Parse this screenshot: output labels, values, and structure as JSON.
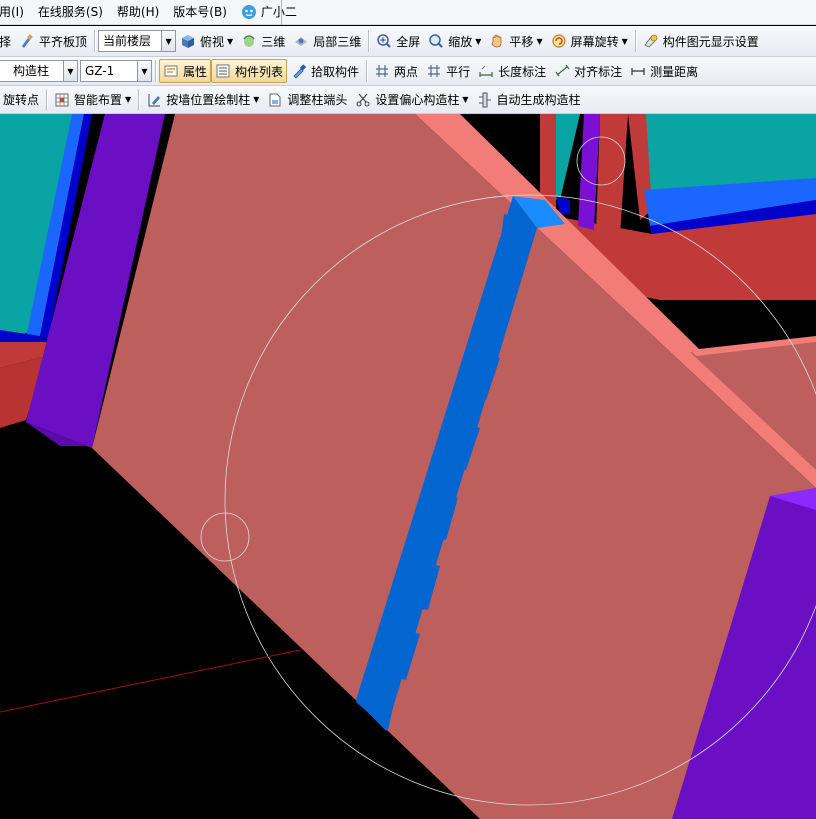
{
  "menu": {
    "items": [
      {
        "label": "用(I)"
      },
      {
        "label": "在线服务(S)"
      },
      {
        "label": "帮助(H)"
      },
      {
        "label": "版本号(B)"
      },
      {
        "label": "广小二"
      }
    ]
  },
  "toolbar1": {
    "left_cut_label": "择",
    "align_slab_top": "平齐板顶",
    "floor_scope_value": "当前楼层",
    "top_view": "俯视",
    "three_d": "三维",
    "local_3d": "局部三维",
    "fullscreen": "全屏",
    "zoom": "缩放",
    "pan": "平移",
    "screen_rotate": "屏幕旋转",
    "display_settings": "构件图元显示设置"
  },
  "toolbar2": {
    "component_type_value": "构造柱",
    "component_name_value": "GZ-1",
    "properties": "属性",
    "component_list": "构件列表",
    "pick_component": "拾取构件",
    "two_points": "两点",
    "parallel": "平行",
    "length_dim": "长度标注",
    "aligned_dim": "对齐标注",
    "measure_distance": "测量距离"
  },
  "toolbar3": {
    "rotate_point": "旋转点",
    "smart_layout": "智能布置",
    "draw_by_wall": "按墙位置绘制柱",
    "adjust_column_end": "调整柱端头",
    "set_eccentric": "设置偏心构造柱",
    "auto_generate": "自动生成构造柱"
  },
  "colors": {
    "wall_face": "#bd5f5d",
    "wall_top": "#f27d78",
    "column_purple": "#6a0fc4",
    "constructional_column_blue": "#0366d0",
    "slab_teal": "#0ba4a4",
    "background": "#000000"
  }
}
